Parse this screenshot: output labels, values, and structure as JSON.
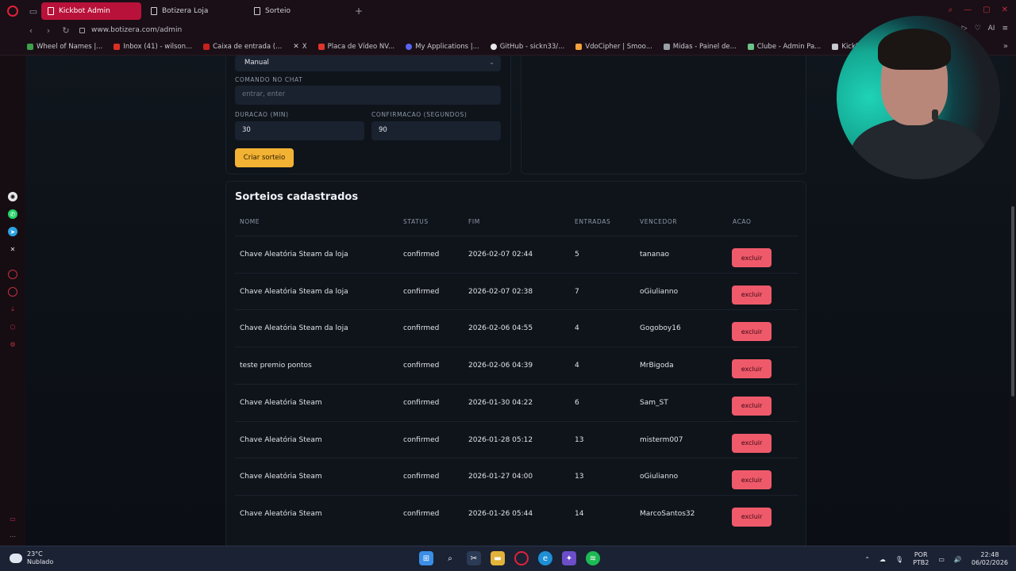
{
  "browser": {
    "tabs": [
      {
        "label": "Kickbot Admin",
        "active": true
      },
      {
        "label": "Botizera Loja",
        "active": false
      },
      {
        "label": "Sorteio",
        "active": false
      }
    ],
    "url": "www.botizera.com/admin",
    "ai_label": "AI",
    "bookmarks": [
      "Wheel of Names |...",
      "Inbox (41) - wilson...",
      "Caixa de entrada (...",
      "X",
      "Placa de Vídeo NV...",
      "My Applications |...",
      "GitHub - sickn33/...",
      "VdoCipher | Smoo...",
      "Midas - Painel de...",
      "Clube - Admin Pa...",
      "Kickbot Admin"
    ]
  },
  "form": {
    "mode_value": "Manual",
    "command_label": "COMANDO NO CHAT",
    "command_placeholder": "entrar, enter",
    "duration_label": "DURACAO (MIN)",
    "duration_value": "30",
    "confirmation_label": "CONFIRMACAO (SEGUNDOS)",
    "confirmation_value": "90",
    "create_button": "Criar sorteio"
  },
  "list": {
    "title": "Sorteios cadastrados",
    "columns": [
      "NOME",
      "STATUS",
      "FIM",
      "ENTRADAS",
      "VENCEDOR",
      "ACAO"
    ],
    "delete_label": "excluir",
    "rows": [
      {
        "nome": "Chave Aleatória Steam da loja",
        "status": "confirmed",
        "fim": "2026-02-07 02:44",
        "entradas": "5",
        "vencedor": "tananao"
      },
      {
        "nome": "Chave Aleatória Steam da loja",
        "status": "confirmed",
        "fim": "2026-02-07 02:38",
        "entradas": "7",
        "vencedor": "oGiulianno"
      },
      {
        "nome": "Chave Aleatória Steam da loja",
        "status": "confirmed",
        "fim": "2026-02-06 04:55",
        "entradas": "4",
        "vencedor": "Gogoboy16"
      },
      {
        "nome": "teste premio pontos",
        "status": "confirmed",
        "fim": "2026-02-06 04:39",
        "entradas": "4",
        "vencedor": "MrBigoda"
      },
      {
        "nome": "Chave Aleatória Steam",
        "status": "confirmed",
        "fim": "2026-01-30 04:22",
        "entradas": "6",
        "vencedor": "Sam_ST"
      },
      {
        "nome": "Chave Aleatória Steam",
        "status": "confirmed",
        "fim": "2026-01-28 05:12",
        "entradas": "13",
        "vencedor": "misterm007"
      },
      {
        "nome": "Chave Aleatória Steam",
        "status": "confirmed",
        "fim": "2026-01-27 04:00",
        "entradas": "13",
        "vencedor": "oGiulianno"
      },
      {
        "nome": "Chave Aleatória Steam",
        "status": "confirmed",
        "fim": "2026-01-26 05:44",
        "entradas": "14",
        "vencedor": "MarcoSantos32"
      }
    ]
  },
  "taskbar": {
    "temperature": "23°C",
    "weather": "Nublado",
    "lang_top": "POR",
    "lang_bottom": "PTB2",
    "time": "22:48",
    "date": "06/02/2026"
  },
  "colors": {
    "accent_red": "#b8123a",
    "create_button": "#f2b233",
    "delete_button": "#ef5a6b"
  }
}
